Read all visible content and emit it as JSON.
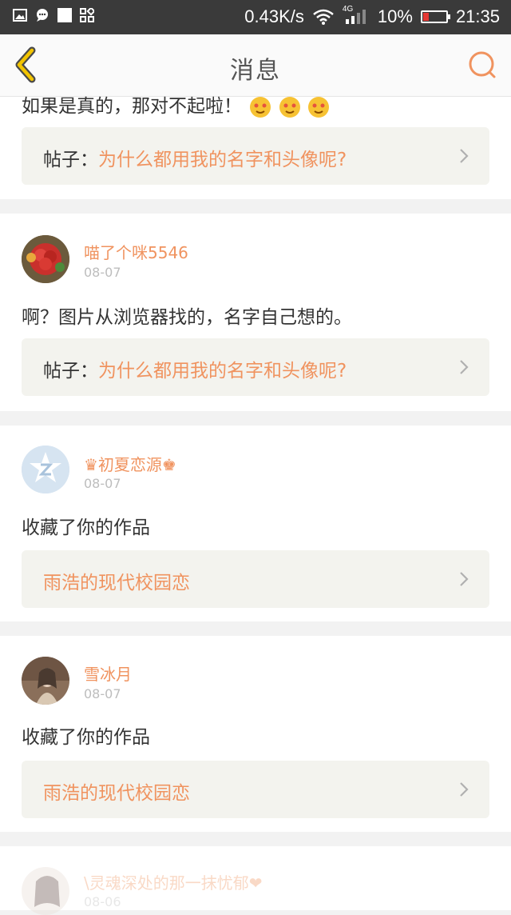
{
  "status_bar": {
    "speed": "0.43K/s",
    "network": "4G",
    "battery": "10%",
    "time": "21:35",
    "icons": [
      "image-icon",
      "chat-icon",
      "square-icon",
      "apps-icon",
      "wifi-icon",
      "signal-icon",
      "battery-icon"
    ]
  },
  "nav": {
    "title": "消息",
    "back_icon": "chevron-left-icon",
    "search_icon": "search-icon"
  },
  "colors": {
    "accent": "#f0935f",
    "back": "#e6b800",
    "status_bg": "#3a3a3a"
  },
  "messages": [
    {
      "text": "如果是真的，那对不起啦！",
      "emoji_count": 3,
      "link_prefix": "帖子：",
      "link_title": "为什么都用我的名字和头像呢?"
    },
    {
      "username": "喵了个咪5546",
      "date": "08-07",
      "text": "啊？图片从浏览器找的，名字自己想的。",
      "link_prefix": "帖子：",
      "link_title": "为什么都用我的名字和头像呢?"
    },
    {
      "username": "♛初夏恋源♚",
      "date": "08-07",
      "text": "收藏了你的作品",
      "link_title": "雨浩的现代校园恋"
    },
    {
      "username": "雪冰月",
      "date": "08-07",
      "text": "收藏了你的作品",
      "link_title": "雨浩的现代校园恋"
    },
    {
      "username": "\\灵魂深处的那一抹忧郁❤",
      "date": "08-06"
    }
  ]
}
